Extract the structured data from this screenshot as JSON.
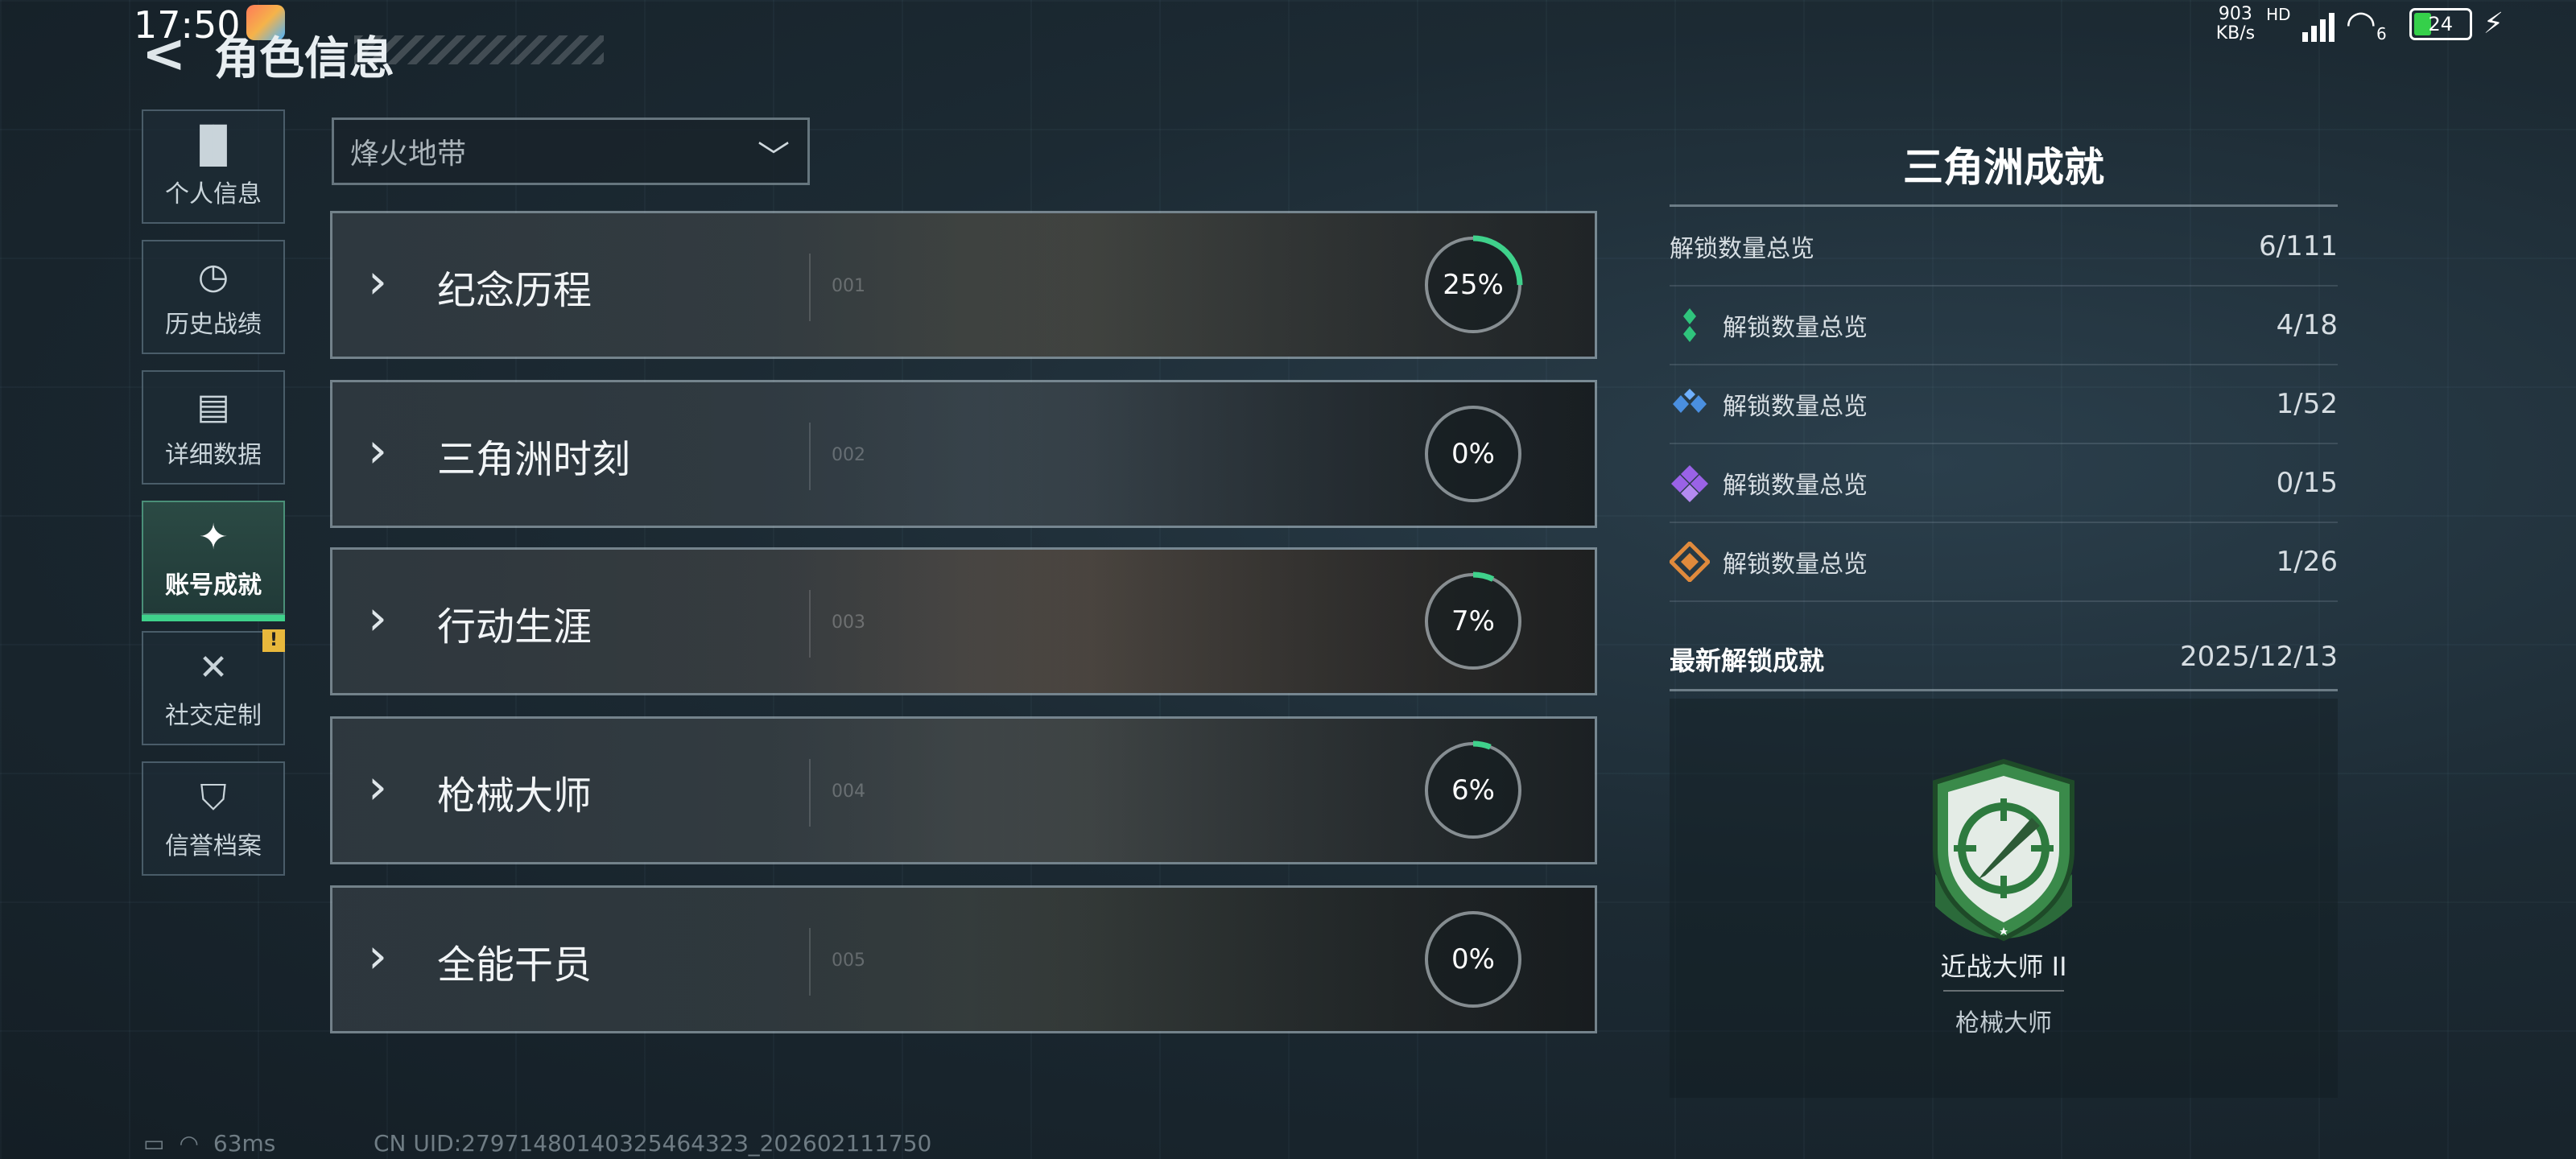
{
  "status_bar": {
    "time": "17:50",
    "net_speed_value": "903",
    "net_speed_unit": "KB/s",
    "hd": "HD",
    "wifi_sub": "6",
    "battery": "24"
  },
  "header": {
    "title": "角色信息"
  },
  "sidebar": {
    "items": [
      {
        "label": "个人信息",
        "icon": "bar-chart-icon"
      },
      {
        "label": "历史战绩",
        "icon": "clock-history-icon"
      },
      {
        "label": "详细数据",
        "icon": "folder-icon"
      },
      {
        "label": "账号成就",
        "icon": "achievement-star-icon",
        "active": true
      },
      {
        "label": "社交定制",
        "icon": "wrench-cross-icon",
        "alert": "!"
      },
      {
        "label": "信誉档案",
        "icon": "shield-badge-icon"
      }
    ]
  },
  "filter": {
    "selected": "烽火地带"
  },
  "categories": [
    {
      "name": "纪念历程",
      "index": "001",
      "percent": 25,
      "percent_label": "25%"
    },
    {
      "name": "三角洲时刻",
      "index": "002",
      "percent": 0,
      "percent_label": "0%"
    },
    {
      "name": "行动生涯",
      "index": "003",
      "percent": 7,
      "percent_label": "7%"
    },
    {
      "name": "枪械大师",
      "index": "004",
      "percent": 6,
      "percent_label": "6%"
    },
    {
      "name": "全能干员",
      "index": "005",
      "percent": 0,
      "percent_label": "0%"
    }
  ],
  "colors": {
    "accent_green": "#3fd18b",
    "gem_green": "#2fc47c",
    "gem_blue": "#4a8fe0",
    "gem_purple": "#9a62e6",
    "gem_orange": "#e08a3c"
  },
  "panel": {
    "title": "三角洲成就",
    "total_label": "解锁数量总览",
    "total_value": "6/111",
    "tiers": [
      {
        "label": "解锁数量总览",
        "value": "4/18",
        "icon": "green-gem-icon"
      },
      {
        "label": "解锁数量总览",
        "value": "1/52",
        "icon": "blue-gem-icon"
      },
      {
        "label": "解锁数量总览",
        "value": "0/15",
        "icon": "purple-gem-icon"
      },
      {
        "label": "解锁数量总览",
        "value": "1/26",
        "icon": "orange-gem-icon"
      }
    ],
    "latest_label": "最新解锁成就",
    "latest_date": "2025/12/13",
    "latest_achievement": {
      "name": "近战大师 II",
      "category": "枪械大师"
    }
  },
  "footer": {
    "ping": "63ms",
    "uid": "CN UID:2797148014032546432З_202602111750"
  }
}
